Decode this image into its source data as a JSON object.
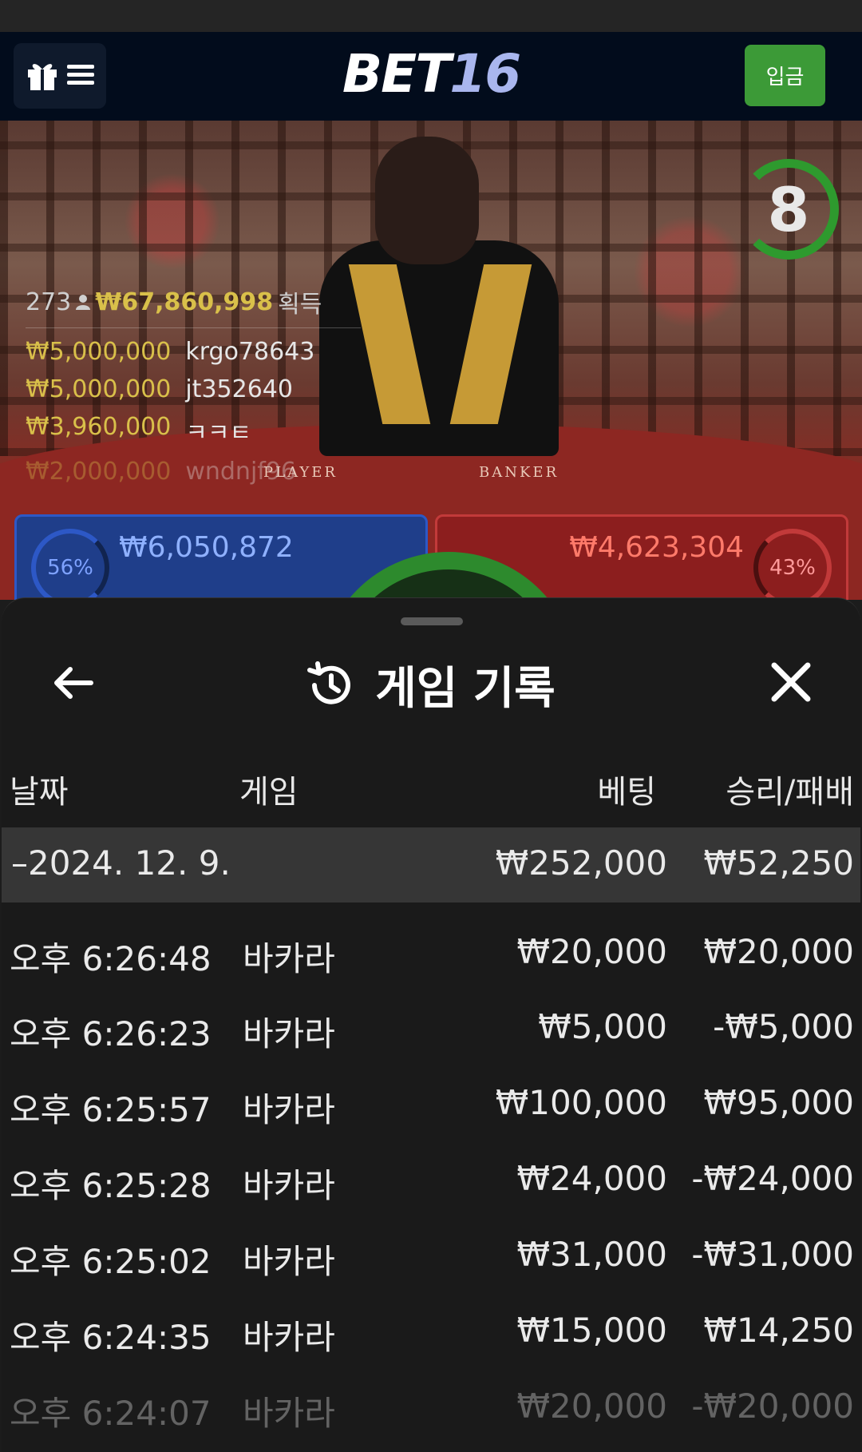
{
  "header": {
    "logo_part1": "BET",
    "logo_part2": "16",
    "deposit_label": "입금"
  },
  "stream": {
    "timer": "8",
    "winners": {
      "count": "273",
      "total": "₩67,860,998",
      "suffix": "획득",
      "rows": [
        {
          "amount": "₩5,000,000",
          "name": "krgo78643"
        },
        {
          "amount": "₩5,000,000",
          "name": "jt352640"
        },
        {
          "amount": "₩3,960,000",
          "name": "ㅋㅋㅌ"
        },
        {
          "amount": "₩2,000,000",
          "name": "wndnjf96"
        }
      ]
    },
    "table_labels": {
      "player": "PLAYER",
      "banker": "BANKER"
    },
    "player": {
      "percent": "56%",
      "pool": "₩6,050,872"
    },
    "banker": {
      "percent": "43%",
      "pool": "₩4,623,304"
    }
  },
  "history": {
    "title": "게임 기록",
    "columns": {
      "date": "날짜",
      "game": "게임",
      "bet": "베팅",
      "result": "승리/패배"
    },
    "date_group": {
      "date": "–2024. 12. 9.",
      "bet": "₩252,000",
      "result": "₩52,250"
    },
    "rows": [
      {
        "time": "오후 6:26:48",
        "game": "바카라",
        "bet": "₩20,000",
        "result": "₩20,000"
      },
      {
        "time": "오후 6:26:23",
        "game": "바카라",
        "bet": "₩5,000",
        "result": "-₩5,000"
      },
      {
        "time": "오후 6:25:57",
        "game": "바카라",
        "bet": "₩100,000",
        "result": "₩95,000"
      },
      {
        "time": "오후 6:25:28",
        "game": "바카라",
        "bet": "₩24,000",
        "result": "-₩24,000"
      },
      {
        "time": "오후 6:25:02",
        "game": "바카라",
        "bet": "₩31,000",
        "result": "-₩31,000"
      },
      {
        "time": "오후 6:24:35",
        "game": "바카라",
        "bet": "₩15,000",
        "result": "₩14,250"
      },
      {
        "time": "오후 6:24:07",
        "game": "바카라",
        "bet": "₩20,000",
        "result": "-₩20,000"
      }
    ]
  }
}
